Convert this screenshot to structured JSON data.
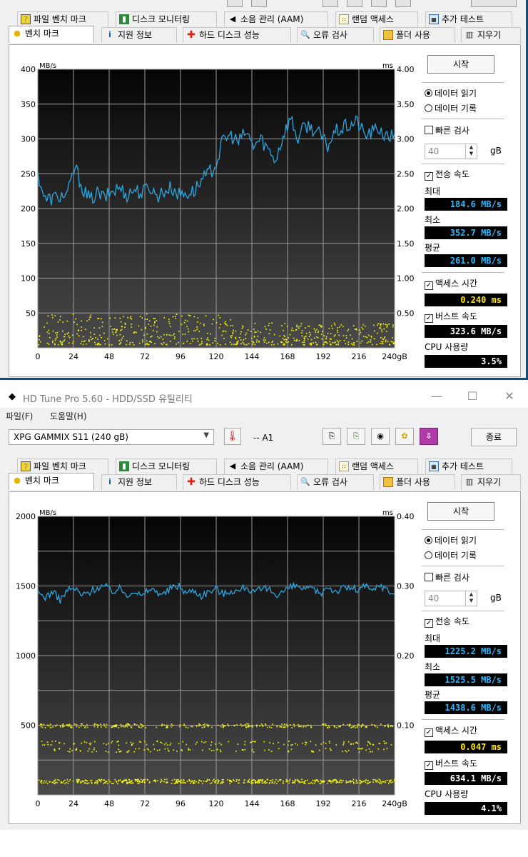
{
  "top_window": {
    "tabs_row1": [
      "파일 벤치 마크",
      "디스크 모니터링",
      "소음 관리 (AAM)",
      "랜덤 액세스",
      "추가 테스트"
    ],
    "tabs_row2": [
      "벤치 마크",
      "지원 정보",
      "하드 디스크 성능",
      "오류 검사",
      "폴더 사용",
      "지우기"
    ],
    "start_button": "시작",
    "read_option": "데이터 읽기",
    "write_option": "데이터 기록",
    "fast_check": "빠른 검사",
    "block_value": "40",
    "block_unit": "gB",
    "transfer_rate": "전송 속도",
    "max_label": "최대",
    "max_value": "184.6 MB/s",
    "min_label": "최소",
    "min_value": "352.7 MB/s",
    "avg_label": "평균",
    "avg_value": "261.0 MB/s",
    "access_label": "액세스 시간",
    "access_value": "0.240 ms",
    "burst_label": "버스트 속도",
    "burst_value": "323.6 MB/s",
    "cpu_label": "CPU 사용량",
    "cpu_value": "3.5%"
  },
  "bottom_window": {
    "title": "HD Tune Pro 5.60 - HDD/SSD  유틸리티",
    "menu": [
      "파일(F)",
      "도움말(H)"
    ],
    "drive": "XPG GAMMIX S11 (240 gB)",
    "temperature": "-- A1",
    "exit_button": "종료",
    "tabs_row1": [
      "파일 벤치 마크",
      "디스크 모니터링",
      "소음 관리 (AAM)",
      "랜덤 액세스",
      "추가 테스트"
    ],
    "tabs_row2": [
      "벤치 마크",
      "지원 정보",
      "하드 디스크 성능",
      "오류 검사",
      "폴더 사용",
      "지우기"
    ],
    "start_button": "시작",
    "read_option": "데이터 읽기",
    "write_option": "데이터 기록",
    "fast_check": "빠른 검사",
    "block_value": "40",
    "block_unit": "gB",
    "transfer_rate": "전송 속도",
    "max_label": "최대",
    "max_value": "1225.2 MB/s",
    "min_label": "최소",
    "min_value": "1525.5 MB/s",
    "avg_label": "평균",
    "avg_value": "1438.6 MB/s",
    "access_label": "액세스 시간",
    "access_value": "0.047 ms",
    "burst_label": "버스트 속도",
    "burst_value": "634.1 MB/s",
    "cpu_label": "CPU 사용량",
    "cpu_value": "4.1%"
  },
  "chart_data": [
    {
      "type": "line",
      "ylabel_left": "MB/s",
      "ylabel_right": "ms",
      "ylim": [
        0,
        400
      ],
      "y2lim": [
        0,
        4.0
      ],
      "yticks_left": [
        "400",
        "350",
        "300",
        "250",
        "200",
        "150",
        "100",
        "50"
      ],
      "yticks_right": [
        "4.00",
        "3.50",
        "3.00",
        "2.50",
        "2.00",
        "1.50",
        "1.00",
        "0.50"
      ],
      "xlim": [
        0,
        240
      ],
      "xticks": [
        "0",
        "24",
        "48",
        "72",
        "96",
        "120",
        "144",
        "168",
        "192",
        "216",
        "240gB"
      ],
      "series": [
        {
          "color": "#2aa7e0",
          "x": [
            0,
            5,
            10,
            15,
            20,
            25,
            30,
            35,
            40,
            45,
            50,
            55,
            60,
            65,
            70,
            75,
            80,
            85,
            90,
            95,
            100,
            105,
            110,
            115,
            120,
            125,
            130,
            135,
            140,
            145,
            150,
            155,
            160,
            165,
            170,
            175,
            180,
            185,
            190,
            195,
            200,
            205,
            210,
            215,
            220,
            225,
            230,
            235,
            240
          ],
          "y": [
            250,
            212,
            215,
            218,
            220,
            260,
            230,
            212,
            222,
            215,
            225,
            230,
            220,
            228,
            222,
            232,
            218,
            225,
            230,
            220,
            222,
            225,
            240,
            250,
            265,
            300,
            305,
            295,
            310,
            290,
            300,
            285,
            270,
            305,
            330,
            300,
            320,
            315,
            305,
            290,
            310,
            315,
            320,
            325,
            305,
            310,
            315,
            300,
            308
          ]
        },
        {
          "color": "#ffff00",
          "type": "scatter",
          "y_range": [
            5,
            50
          ],
          "y_axis": "right"
        }
      ]
    },
    {
      "type": "line",
      "ylabel_left": "MB/s",
      "ylabel_right": "ms",
      "ylim": [
        0,
        2000
      ],
      "y2lim": [
        0,
        0.4
      ],
      "yticks_left": [
        "2000",
        "1500",
        "1000",
        "500"
      ],
      "yticks_right": [
        "0.40",
        "0.30",
        "0.20",
        "0.10"
      ],
      "xlim": [
        0,
        240
      ],
      "xticks": [
        "0",
        "24",
        "48",
        "72",
        "96",
        "120",
        "144",
        "168",
        "192",
        "216",
        "240gB"
      ],
      "series": [
        {
          "color": "#2aa7e0",
          "x": [
            0,
            5,
            10,
            15,
            20,
            25,
            30,
            35,
            40,
            45,
            50,
            55,
            60,
            65,
            70,
            75,
            80,
            85,
            90,
            95,
            100,
            105,
            110,
            115,
            120,
            125,
            130,
            135,
            140,
            145,
            150,
            155,
            160,
            165,
            170,
            175,
            180,
            185,
            190,
            195,
            200,
            205,
            210,
            215,
            220,
            225,
            230,
            235,
            240
          ],
          "y": [
            1450,
            1420,
            1460,
            1400,
            1470,
            1480,
            1430,
            1460,
            1490,
            1500,
            1460,
            1480,
            1440,
            1470,
            1420,
            1480,
            1460,
            1440,
            1490,
            1500,
            1450,
            1470,
            1430,
            1460,
            1480,
            1440,
            1470,
            1460,
            1500,
            1450,
            1470,
            1480,
            1440,
            1460,
            1490,
            1500,
            1470,
            1480,
            1440,
            1500,
            1460,
            1480,
            1490,
            1470,
            1500,
            1460,
            1510,
            1470,
            1440
          ]
        },
        {
          "color": "#ffff00",
          "type": "scatter",
          "y_bands_ms": [
            0.1,
            0.075,
            0.065,
            0.02
          ]
        }
      ]
    }
  ]
}
